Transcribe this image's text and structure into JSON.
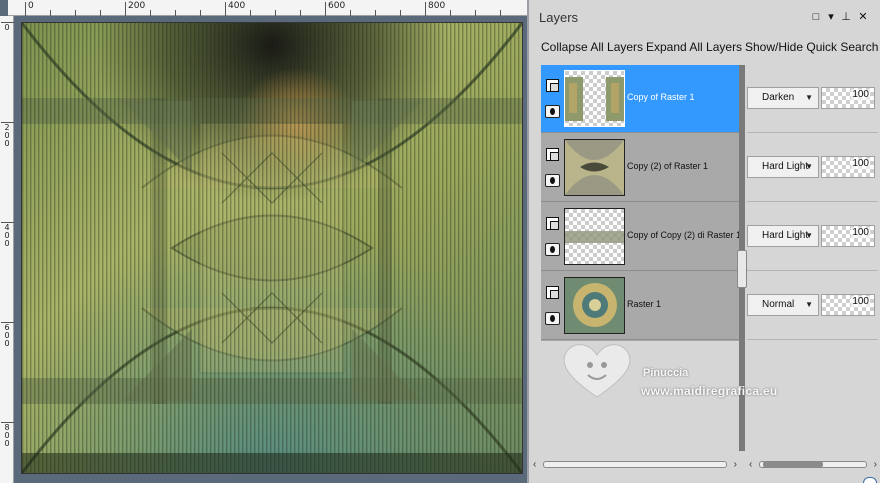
{
  "rulers": {
    "top_labels": [
      "0",
      "200",
      "400",
      "600",
      "800"
    ],
    "left_labels": [
      "0",
      "2\n0\n0",
      "4\n0\n0",
      "6\n0\n0",
      "8\n0\n0"
    ]
  },
  "panel": {
    "title": "Layers",
    "toolbar": {
      "collapse_all": "Collapse All Layers",
      "expand_all": "Expand All Layers",
      "quick_search": "Show/Hide Quick Search"
    }
  },
  "layers": [
    {
      "name": "Copy of Raster 1",
      "blend_mode": "Darken",
      "opacity": "100",
      "selected": true
    },
    {
      "name": "Copy (2) of Raster 1",
      "blend_mode": "Hard Light",
      "opacity": "100",
      "selected": false
    },
    {
      "name": "Copy of Copy (2) di Raster 1",
      "blend_mode": "Hard Light",
      "opacity": "100",
      "selected": false
    },
    {
      "name": "Raster 1",
      "blend_mode": "Normal",
      "opacity": "100",
      "selected": false
    }
  ],
  "watermark": {
    "line1": "Pinuccia",
    "line2": "www.maidiregrafica.eu"
  },
  "colors": {
    "selection": "#3399ff",
    "canvas_green": "#8fa866",
    "canvas_teal": "#5b8a78"
  }
}
